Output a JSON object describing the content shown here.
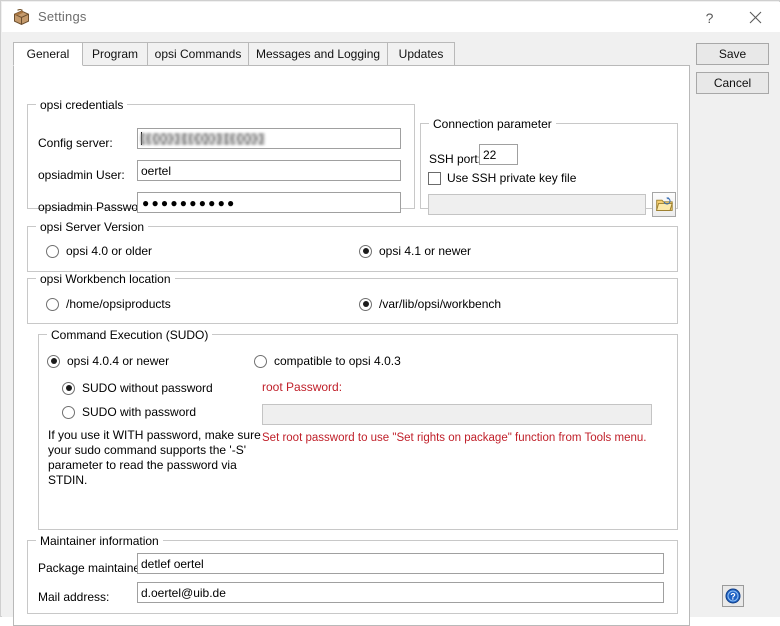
{
  "window": {
    "title": "Settings",
    "icon": "package-box-icon",
    "help_button": "?",
    "close_button": "✕"
  },
  "tabs": [
    {
      "label": "General",
      "selected": true
    },
    {
      "label": "Program",
      "selected": false
    },
    {
      "label": "opsi Commands",
      "selected": false
    },
    {
      "label": "Messages and Logging",
      "selected": false
    },
    {
      "label": "Updates",
      "selected": false
    }
  ],
  "side_buttons": {
    "save_label": "Save",
    "cancel_label": "Cancel"
  },
  "help_icon": "question-circle-icon",
  "groups": {
    "credentials": {
      "legend": "opsi credentials",
      "config_server_label": "Config server:",
      "config_server_value": "",
      "config_server_redacted": true,
      "opsiadmin_user_label": "opsiadmin User:",
      "opsiadmin_user_value": "oertel",
      "opsiadmin_password_label": "opsiadmin Password:",
      "opsiadmin_password_mask": "●●●●●●●●●●"
    },
    "connection": {
      "legend": "Connection parameter",
      "ssh_port_label": "SSH port:",
      "ssh_port_value": "22",
      "use_key_label": "Use SSH private key file",
      "use_key_checked": false,
      "key_path_value": "",
      "key_path_enabled": false,
      "browse_icon": "open-folder-icon"
    },
    "server_version": {
      "legend": "opsi Server Version",
      "option_old": "opsi 4.0 or older",
      "option_old_selected": false,
      "option_new": "opsi 4.1 or newer",
      "option_new_selected": true
    },
    "workbench": {
      "legend": "opsi Workbench location",
      "option_home": "/home/opsiproducts",
      "option_home_selected": false,
      "option_var": "/var/lib/opsi/workbench",
      "option_var_selected": true
    },
    "sudo": {
      "legend": "Command Execution (SUDO)",
      "option_404": "opsi 4.0.4 or newer",
      "option_404_selected": true,
      "option_403": "compatible to opsi 4.0.3",
      "option_403_selected": false,
      "sudo_without_password": "SUDO without password",
      "sudo_without_password_selected": true,
      "sudo_with_password": "SUDO with password",
      "sudo_with_password_selected": false,
      "hint": "If you use it WITH password, make sure your sudo command supports the '-S' parameter to read the password via STDIN.",
      "root_password_label": "root Password:",
      "root_password_value": "",
      "root_password_enabled": false,
      "root_password_note": "Set root password to use \"Set rights on package\" function from Tools menu."
    },
    "maintainer": {
      "legend": "Maintainer information",
      "package_maintainer_label": "Package maintainer:",
      "package_maintainer_value": "detlef oertel",
      "mail_address_label": "Mail address:",
      "mail_address_value": "d.oertel@uib.de"
    }
  },
  "colors": {
    "red_warning": "#c0202a",
    "window_chrome": "#f0f0f0",
    "panel": "#ffffff"
  }
}
